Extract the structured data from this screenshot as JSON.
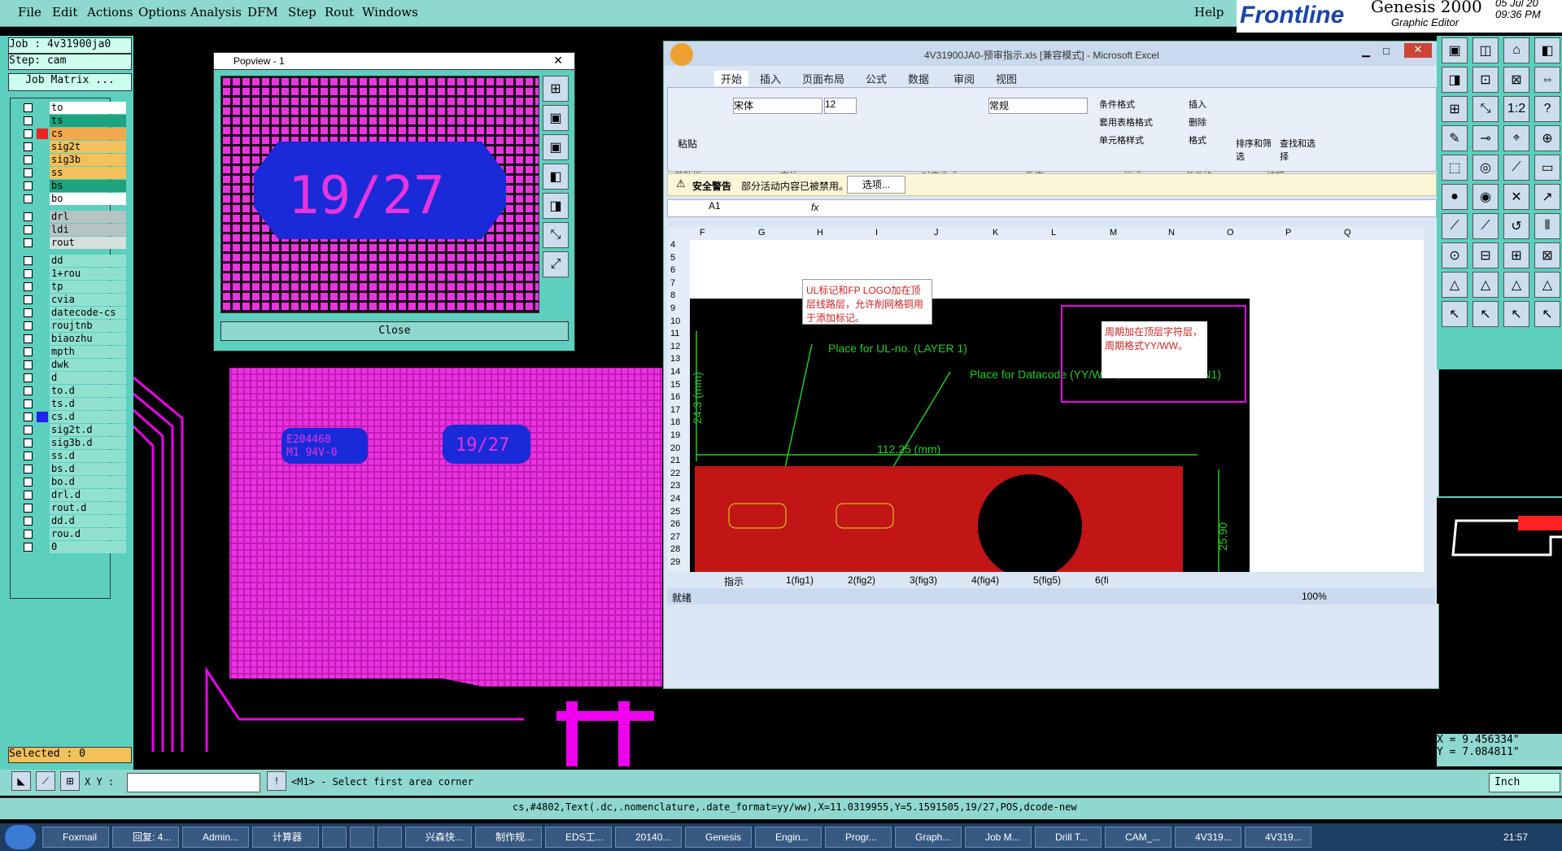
{
  "menu": [
    "File",
    "Edit",
    "Actions",
    "Options",
    "Analysis",
    "DFM",
    "Step",
    "Rout",
    "Windows"
  ],
  "help": "Help",
  "brand": {
    "logo": "Frontline",
    "product": "Genesis 2000",
    "subtitle": "Graphic Editor",
    "date": "05 Jul 20",
    "time": "09:36 PM"
  },
  "job": {
    "job": "Job : 4v31900ja0",
    "step": "Step: cam",
    "matrix": "Job Matrix ..."
  },
  "layers": [
    {
      "n": "to",
      "c": "#ffffff"
    },
    {
      "n": "ts",
      "c": "#1fa37f"
    },
    {
      "n": "cs",
      "c": "#f2a84a"
    },
    {
      "n": "sig2t",
      "c": "#f2c15c"
    },
    {
      "n": "sig3b",
      "c": "#f2c15c"
    },
    {
      "n": "ss",
      "c": "#f2c15c"
    },
    {
      "n": "bs",
      "c": "#1fa37f"
    },
    {
      "n": "bo",
      "c": "#ffffff"
    },
    {
      "n": "drl",
      "c": "#b6c3c3"
    },
    {
      "n": "ldi",
      "c": "#b6c3c3"
    },
    {
      "n": "rout",
      "c": "#d6dede"
    },
    {
      "n": "dd",
      "c": "#90e0d0"
    },
    {
      "n": "1+rou",
      "c": "#90e0d0"
    },
    {
      "n": "tp",
      "c": "#90e0d0"
    },
    {
      "n": "cvia",
      "c": "#90e0d0"
    },
    {
      "n": "datecode-cs",
      "c": "#90e0d0"
    },
    {
      "n": "roujtnb",
      "c": "#90e0d0"
    },
    {
      "n": "biaozhu",
      "c": "#90e0d0"
    },
    {
      "n": "mpth",
      "c": "#90e0d0"
    },
    {
      "n": "dwk",
      "c": "#90e0d0"
    },
    {
      "n": "d",
      "c": "#90e0d0"
    },
    {
      "n": "to.d",
      "c": "#90e0d0"
    },
    {
      "n": "ts.d",
      "c": "#90e0d0"
    },
    {
      "n": "cs.d",
      "c": "#90e0d0"
    },
    {
      "n": "sig2t.d",
      "c": "#90e0d0"
    },
    {
      "n": "sig3b.d",
      "c": "#90e0d0"
    },
    {
      "n": "ss.d",
      "c": "#90e0d0"
    },
    {
      "n": "bs.d",
      "c": "#90e0d0"
    },
    {
      "n": "bo.d",
      "c": "#90e0d0"
    },
    {
      "n": "drl.d",
      "c": "#90e0d0"
    },
    {
      "n": "rout.d",
      "c": "#90e0d0"
    },
    {
      "n": "dd.d",
      "c": "#90e0d0"
    },
    {
      "n": "rou.d",
      "c": "#90e0d0"
    },
    {
      "n": "0",
      "c": "#90e0d0"
    }
  ],
  "selected": "Selected : 0",
  "popview": {
    "title": "Popview - 1",
    "close": "Close",
    "marking": "19/27"
  },
  "board": {
    "ul_text1": "E204460",
    "ul_text2": "M1 94V-0",
    "datecode": "19/27"
  },
  "excel": {
    "title": "4V31900JA0-预审指示.xls [兼容模式] - Microsoft Excel",
    "tabs": [
      "开始",
      "插入",
      "页面布局",
      "公式",
      "数据",
      "审阅",
      "视图"
    ],
    "clipboard": "剪贴板",
    "paste": "粘贴",
    "font_group": "字体",
    "align_group": "对齐方式",
    "number_group": "数字",
    "styles_group": "样式",
    "cells_group": "单元格",
    "edit_group": "编辑",
    "font_name": "宋体",
    "font_size": "12",
    "number_format": "常规",
    "cond_format": "条件格式",
    "table_format": "套用表格格式",
    "cell_style": "单元格样式",
    "insert": "插入",
    "delete": "删除",
    "format": "格式",
    "sort": "排序和筛选",
    "find": "查找和选择",
    "security_label": "安全警告",
    "security_text": "部分活动内容已被禁用。",
    "options": "选项...",
    "name_box": "A1",
    "fx": "fx",
    "cols": [
      "F",
      "G",
      "H",
      "I",
      "J",
      "K",
      "L",
      "M",
      "N",
      "O",
      "P",
      "Q"
    ],
    "rows": [
      "4",
      "5",
      "6",
      "7",
      "8",
      "9",
      "10",
      "11",
      "12",
      "13",
      "14",
      "15",
      "16",
      "17",
      "18",
      "19",
      "20",
      "21",
      "22",
      "23",
      "24",
      "25",
      "26",
      "27",
      "28",
      "29"
    ],
    "note1": "UL标记和FP LOGO加在顶层线路层，允许削网格铜用于添加标记。",
    "note2": "周期加在顶层字符层，周期格式YY/WW。",
    "dim1": "Place for UL-no. (LAYER 1)",
    "dim2": "Place for Datacode (YY/WW , on SILKSCREEN1)",
    "dim_w": "112.25 (mm)",
    "dim_h": "24.3 (mm)",
    "dim_r": "25.90",
    "sheets": [
      "指示",
      "1(fig1)",
      "2(fig2)",
      "3(fig3)",
      "4(fig4)",
      "5(fig5)",
      "6(fi"
    ],
    "status": "就绪",
    "zoom": "100%"
  },
  "coords": {
    "x": "X = 9.456334\"",
    "y": "Y = 7.084811\""
  },
  "cmd": {
    "xy_label": "X Y :",
    "prompt": "<M1> - Select first area corner",
    "unit": "Inch"
  },
  "statusline": "cs,#4802,Text(.dc,.nomenclature,.date_format=yy/ww),X=11.0319955,Y=5.1591505,19/27,POS,dcode-new",
  "taskbar": {
    "tasks": [
      "Foxmail",
      "回复: 4...",
      "Admin...",
      "计算器",
      "",
      "",
      "",
      "兴森快...",
      "制作规...",
      "EDS工...",
      "20140...",
      "Genesis",
      "Engin...",
      "Progr...",
      "Graph...",
      "Job M...",
      "Drill T...",
      "CAM_...",
      "4V319...",
      "4V319..."
    ],
    "clock": "21:57"
  }
}
